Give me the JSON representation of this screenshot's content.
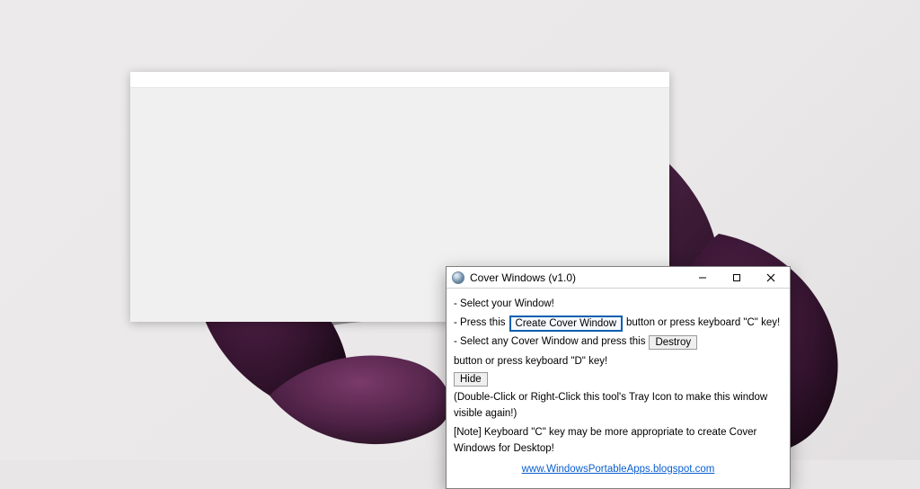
{
  "app": {
    "title": "Cover Windows (v1.0)",
    "lines": {
      "select_window": "- Select your Window!",
      "press_this_prefix": "- Press this",
      "press_this_suffix": " button or press keyboard \"C\" key!",
      "destroy_prefix": "- Select any Cover Window and press this",
      "destroy_suffix": " button or press keyboard \"D\" key!",
      "hide_hint": "(Double-Click or Right-Click this tool's Tray Icon to make this window visible again!)",
      "note": "[Note] Keyboard \"C\" key may be more appropriate to create Cover Windows for Desktop!"
    },
    "buttons": {
      "create": "Create Cover Window",
      "destroy": "Destroy",
      "hide": "Hide"
    },
    "link": "www.WindowsPortableApps.blogspot.com"
  }
}
